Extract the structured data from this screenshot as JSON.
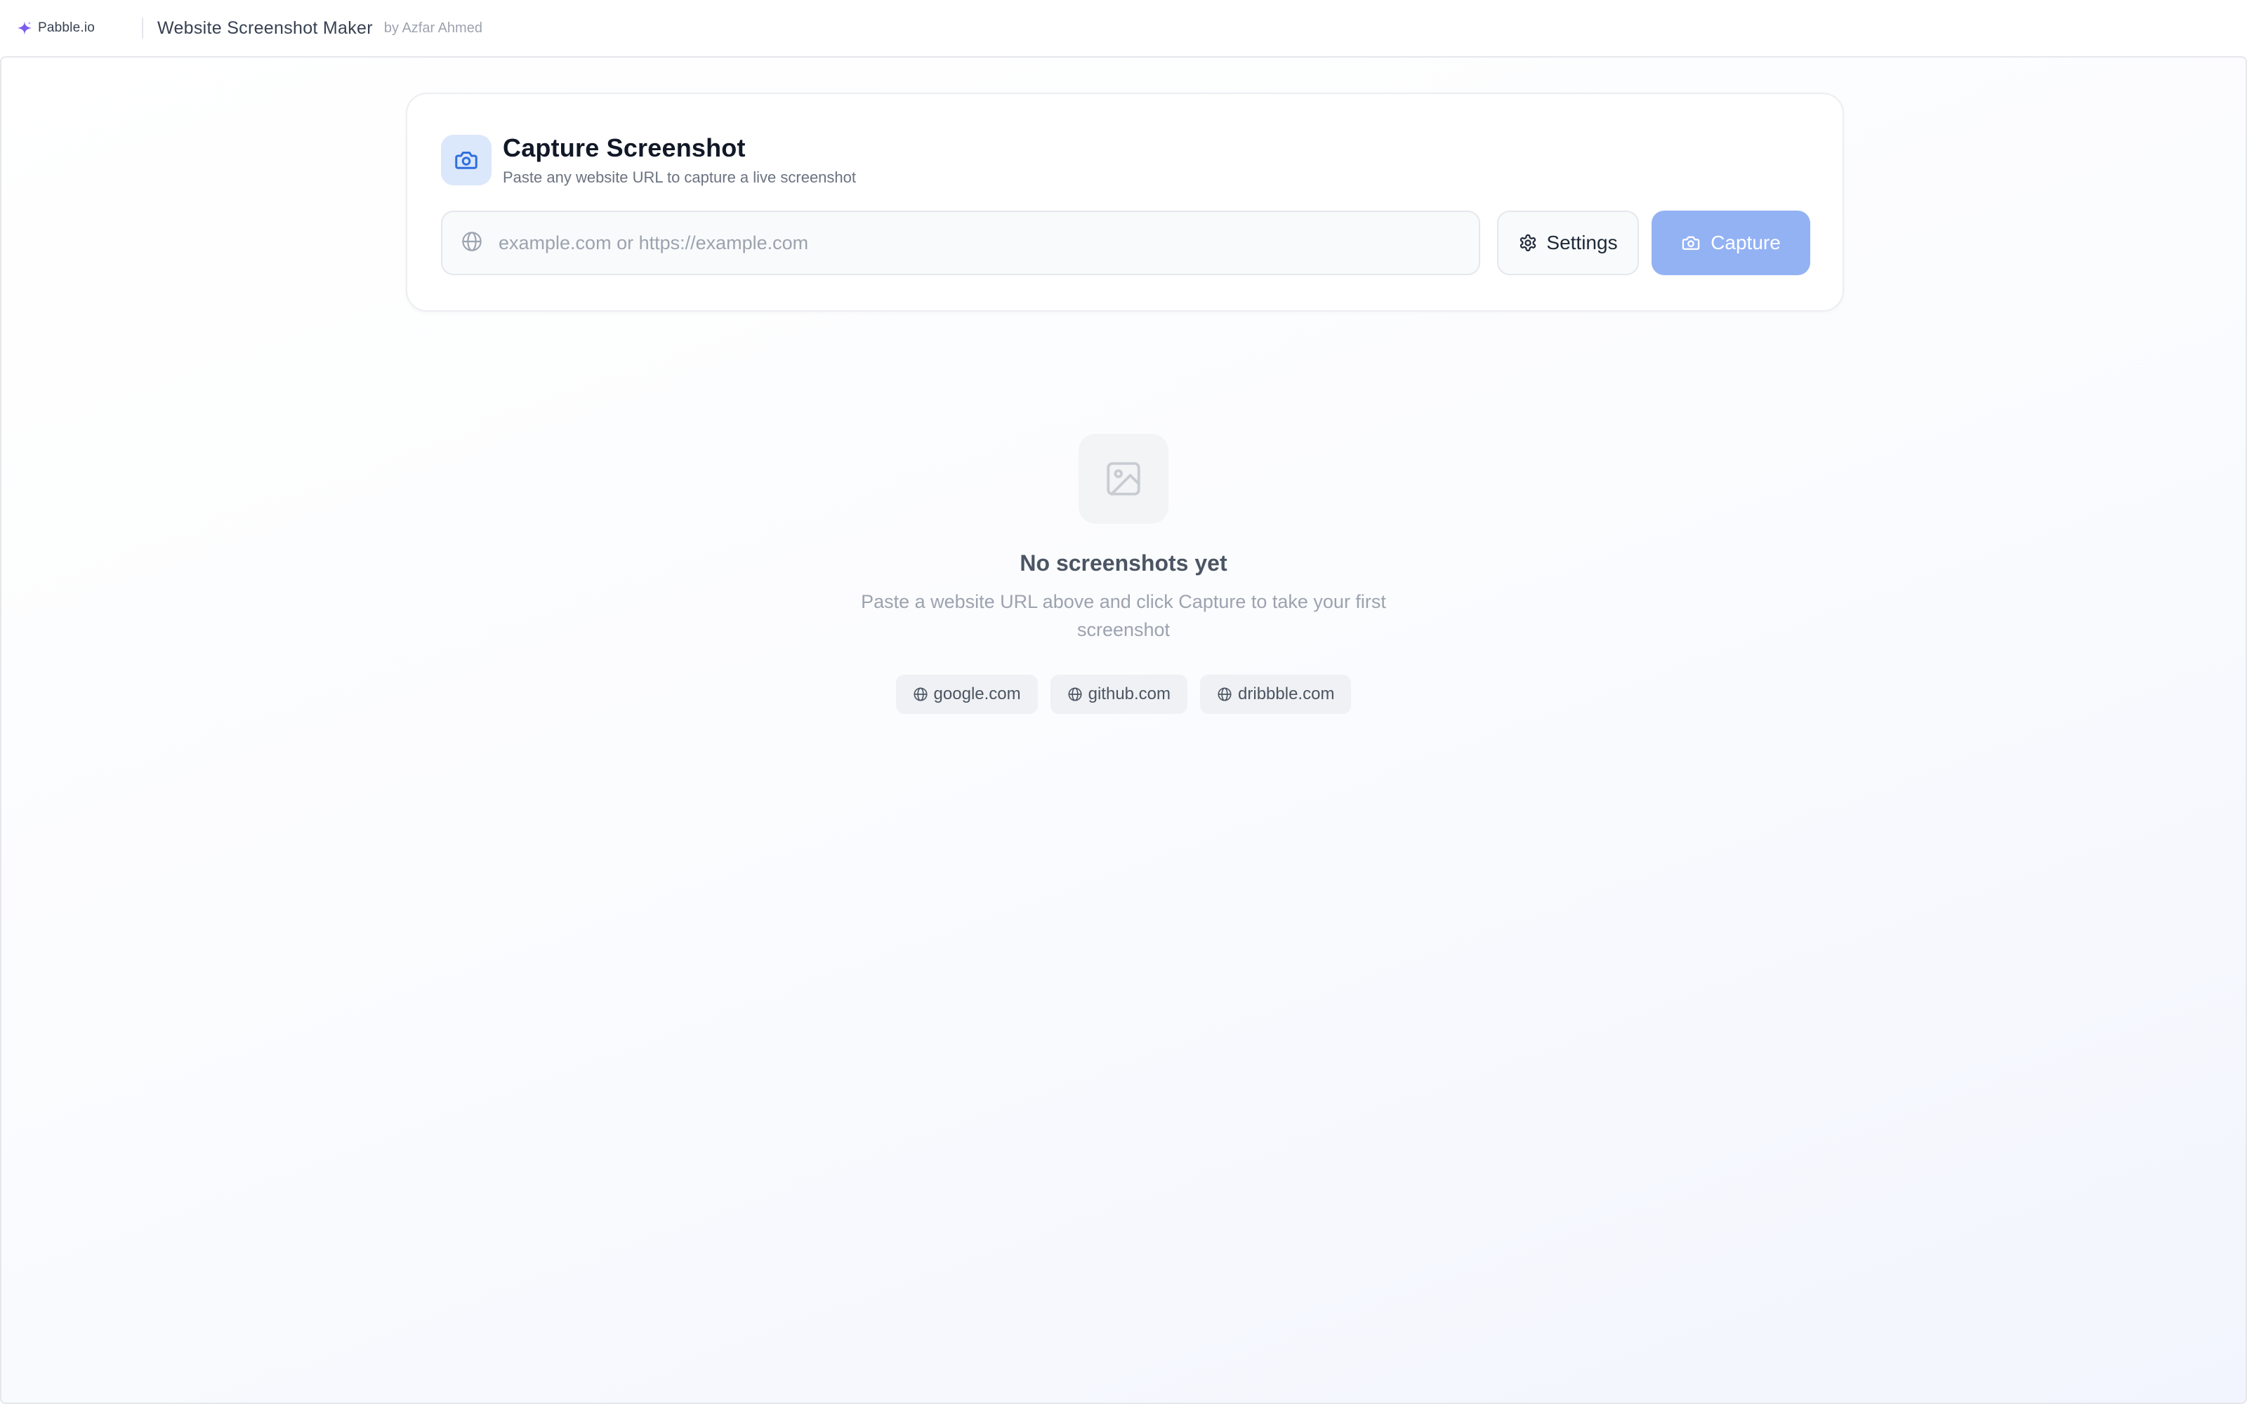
{
  "header": {
    "brand_name": "Pabble.io",
    "app_title": "Website Screenshot Maker",
    "author": "by Azfar Ahmed"
  },
  "capture_card": {
    "title": "Capture Screenshot",
    "subtitle": "Paste any website URL to capture a live screenshot",
    "url_input": {
      "value": "",
      "placeholder": "example.com or https://example.com"
    },
    "settings_label": "Settings",
    "capture_label": "Capture"
  },
  "empty_state": {
    "title": "No screenshots yet",
    "description": "Paste a website URL above and click Capture to take your first screenshot",
    "suggestions": [
      {
        "label": "google.com"
      },
      {
        "label": "github.com"
      },
      {
        "label": "dribbble.com"
      }
    ]
  },
  "icons": {
    "brand": "sparkle-icon",
    "camera": "camera-icon",
    "globe": "globe-icon",
    "settings": "gear-icon",
    "empty": "image-icon"
  },
  "colors": {
    "accent": "#93b2f4",
    "camera_badge": "#dbe7fb",
    "brand_icon": "#7c5cf0",
    "camera_icon": "#2f6fde"
  }
}
